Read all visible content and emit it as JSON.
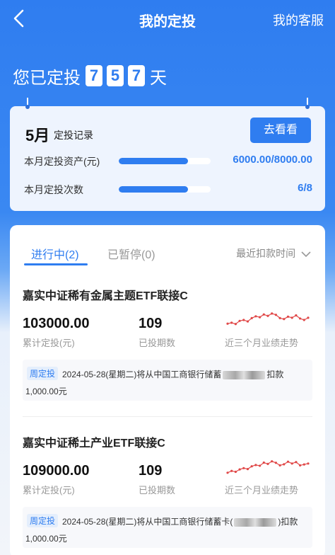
{
  "header": {
    "title": "我的定投",
    "service_label": "我的客服"
  },
  "days": {
    "prefix": "您已定投",
    "digits": [
      "7",
      "5",
      "7"
    ],
    "suffix": "天"
  },
  "summary": {
    "month": "5月",
    "month_sub": "定投记录",
    "button": "去看看",
    "stats": [
      {
        "label": "本月定投资产(元)",
        "value": "6000.00/8000.00",
        "progress": 0.75
      },
      {
        "label": "本月定投次数",
        "value": "6/8",
        "progress": 0.75
      }
    ]
  },
  "tabs": [
    {
      "label": "进行中(2)",
      "active": true
    },
    {
      "label": "已暂停(0)",
      "active": false
    }
  ],
  "sort_label": "最近扣款时间",
  "funds": [
    {
      "name": "嘉实中证稀有金属主题ETF联接C",
      "amount": "103000.00",
      "amount_label": "累计定投(元)",
      "count": "109",
      "count_label": "已投期数",
      "trend_label": "近三个月业绩走势",
      "trend": [
        0.3,
        0.35,
        0.28,
        0.45,
        0.5,
        0.42,
        0.6,
        0.7,
        0.65,
        0.8,
        0.72,
        0.85,
        0.78,
        0.6,
        0.55,
        0.68,
        0.62,
        0.75,
        0.58,
        0.5,
        0.62
      ],
      "tag": "周定投",
      "notice_text": "2024-05-28(星期二)将从中国工商银行储蓄",
      "notice_tail": "扣款",
      "notice_amount": "1,000.00元"
    },
    {
      "name": "嘉实中证稀土产业ETF联接C",
      "amount": "109000.00",
      "amount_label": "累计定投(元)",
      "count": "109",
      "count_label": "已投期数",
      "trend_label": "近三个月业绩走势",
      "trend": [
        0.2,
        0.3,
        0.25,
        0.38,
        0.45,
        0.4,
        0.55,
        0.62,
        0.58,
        0.75,
        0.68,
        0.82,
        0.74,
        0.6,
        0.66,
        0.8,
        0.7,
        0.78,
        0.6,
        0.65,
        0.7
      ],
      "tag": "周定投",
      "notice_text": "2024-05-28(星期二)将从中国工商银行储蓄卡(",
      "notice_tail": ")扣款",
      "notice_amount": "1,000.00元"
    }
  ],
  "colors": {
    "accent": "#2f7df0",
    "trend": "#e04848"
  }
}
